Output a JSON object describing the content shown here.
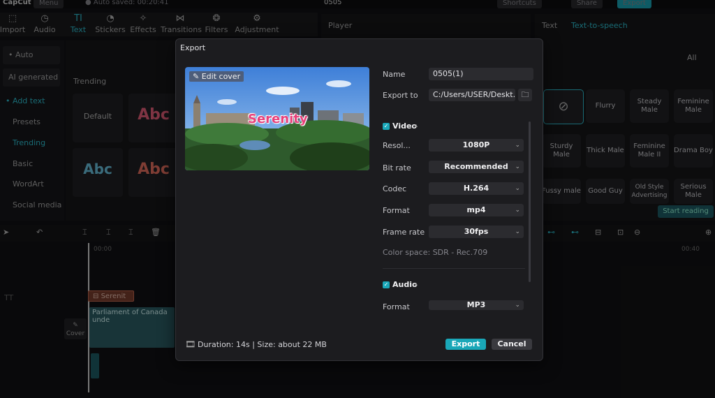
{
  "app": {
    "logo": "CapCut",
    "menu": "Menu",
    "autosave": "Auto saved: 00:20:41",
    "project": "0505",
    "shortcuts": "Shortcuts",
    "share": "Share",
    "export": "Export"
  },
  "tools": [
    {
      "label": "Import",
      "icon": "import-icon"
    },
    {
      "label": "Audio",
      "icon": "audio-icon"
    },
    {
      "label": "Text",
      "icon": "text-icon"
    },
    {
      "label": "Stickers",
      "icon": "sticker-icon"
    },
    {
      "label": "Effects",
      "icon": "effects-icon"
    },
    {
      "label": "Transitions",
      "icon": "transitions-icon"
    },
    {
      "label": "Filters",
      "icon": "filters-icon"
    },
    {
      "label": "Adjustment",
      "icon": "adjustment-icon"
    }
  ],
  "sidebar": {
    "items": [
      "• Auto captio...",
      "AI generated",
      "• Add text",
      "Presets",
      "Trending",
      "Basic",
      "WordArt",
      "Social media"
    ]
  },
  "content": {
    "section": "Trending",
    "default_tile": "Default",
    "abc": "Abc"
  },
  "player": {
    "title": "Player"
  },
  "rpanel": {
    "tab_text": "Text",
    "tab_tts": "Text-to-speech",
    "filter": "All",
    "voices": [
      "Flurry",
      "Steady Male",
      "Feminine Male",
      "Sturdy Male",
      "Thick Male",
      "Feminine Male II",
      "Drama Boy",
      "Fussy male",
      "Good Guy",
      "Old Style Advertising",
      "Serious Male"
    ],
    "start_reading": "Start reading"
  },
  "timeline": {
    "t0": "00:00",
    "t1": "00:40",
    "text_clip": "Serenit",
    "video_clip": "Parliament of Canada unde",
    "cover": "Cover"
  },
  "dialog": {
    "title": "Export",
    "edit_cover": "Edit cover",
    "cover_text": "Serenity",
    "name_label": "Name",
    "name_value": "0505(1)",
    "exportto_label": "Export to",
    "exportto_value": "C:/Users/USER/Deskt...",
    "video_label": "Video",
    "rows": [
      {
        "label": "Resol...",
        "value": "1080P"
      },
      {
        "label": "Bit rate",
        "value": "Recommended"
      },
      {
        "label": "Codec",
        "value": "H.264"
      },
      {
        "label": "Format",
        "value": "mp4"
      },
      {
        "label": "Frame rate",
        "value": "30fps"
      }
    ],
    "colorspace": "Color space: SDR - Rec.709",
    "audio_label": "Audio",
    "audio_format_label": "Format",
    "audio_format_value": "MP3",
    "footer": "Duration: 14s | Size: about 22 MB",
    "export_btn": "Export",
    "cancel_btn": "Cancel"
  },
  "colors": {
    "accent": "#1aa7b8",
    "cover_text": "#e8407a"
  }
}
